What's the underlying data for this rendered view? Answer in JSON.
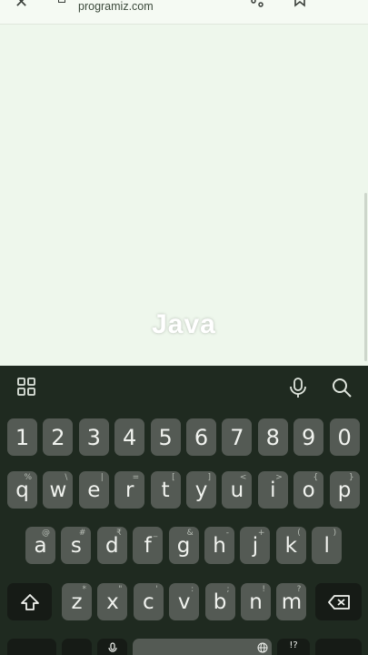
{
  "browser": {
    "url": "programiz.com",
    "icons": [
      "close-icon",
      "lock-icon",
      "share-icon",
      "bookmark-icon",
      "more-icon"
    ]
  },
  "page": {
    "watermark": "Java"
  },
  "keyboard": {
    "toolbar_icons": [
      "grid-icon",
      "mic-icon",
      "search-icon"
    ],
    "row_numbers": [
      "1",
      "2",
      "3",
      "4",
      "5",
      "6",
      "7",
      "8",
      "9",
      "0"
    ],
    "row_top": [
      {
        "key": "q",
        "hint": "%"
      },
      {
        "key": "w",
        "hint": "\\"
      },
      {
        "key": "e",
        "hint": "|"
      },
      {
        "key": "r",
        "hint": "="
      },
      {
        "key": "t",
        "hint": "["
      },
      {
        "key": "y",
        "hint": "]"
      },
      {
        "key": "u",
        "hint": "<"
      },
      {
        "key": "i",
        "hint": ">"
      },
      {
        "key": "o",
        "hint": "{"
      },
      {
        "key": "p",
        "hint": "}"
      }
    ],
    "row_middle": [
      {
        "key": "a",
        "hint": "@"
      },
      {
        "key": "s",
        "hint": "#"
      },
      {
        "key": "d",
        "hint": "₹"
      },
      {
        "key": "f",
        "hint": "_"
      },
      {
        "key": "g",
        "hint": "&"
      },
      {
        "key": "h",
        "hint": "-"
      },
      {
        "key": "j",
        "hint": "+"
      },
      {
        "key": "k",
        "hint": "("
      },
      {
        "key": "l",
        "hint": ")"
      }
    ],
    "row_bottom": [
      {
        "key": "z",
        "hint": "*"
      },
      {
        "key": "x",
        "hint": "\""
      },
      {
        "key": "c",
        "hint": "'"
      },
      {
        "key": "v",
        "hint": ":"
      },
      {
        "key": "b",
        "hint": ";"
      },
      {
        "key": "n",
        "hint": "!"
      },
      {
        "key": "m",
        "hint": "?"
      }
    ],
    "symbols_label": "!?"
  }
}
